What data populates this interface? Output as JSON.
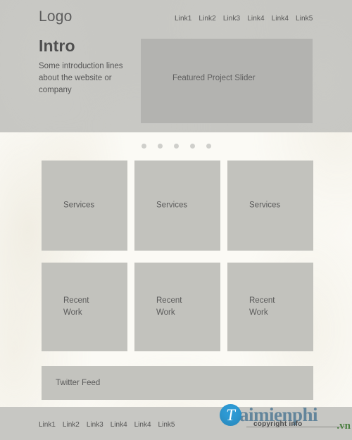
{
  "colors": {
    "header_band": "#c7c7c3",
    "footer_band": "#c7c7c3",
    "body_background": "#fbfaf5",
    "card_fill": "#c2c2bd",
    "slider_fill": "#b3b3b0",
    "twitter_fill": "#c3c3be",
    "dot_fill": "#cfcfcb",
    "text_primary": "#4f4f4f",
    "text_secondary": "#565656",
    "watermark_badge": "#2e9ad4",
    "watermark_word": "#63859b",
    "watermark_tld": "#4a7f3f"
  },
  "header": {
    "logo": "Logo",
    "nav": [
      {
        "label": "Link1"
      },
      {
        "label": "Link2"
      },
      {
        "label": "Link3"
      },
      {
        "label": "Link4"
      },
      {
        "label": "Link4"
      },
      {
        "label": "Link5"
      }
    ],
    "intro": {
      "title": "Intro",
      "body": "Some introduction lines about the website or company"
    },
    "slider": {
      "label": "Featured Project Slider"
    }
  },
  "slider_dots": {
    "count": 5,
    "active_index": null
  },
  "main": {
    "services": [
      {
        "label": "Services"
      },
      {
        "label": "Services"
      },
      {
        "label": "Services"
      }
    ],
    "recent_work": [
      {
        "label": "Recent\nWork"
      },
      {
        "label": "Recent\nWork"
      },
      {
        "label": "Recent\nWork"
      }
    ],
    "twitter_feed": {
      "label": "Twitter Feed"
    }
  },
  "footer": {
    "nav": [
      {
        "label": "Link1"
      },
      {
        "label": "Link2"
      },
      {
        "label": "Link3"
      },
      {
        "label": "Link4"
      },
      {
        "label": "Link4"
      },
      {
        "label": "Link5"
      }
    ]
  },
  "watermark": {
    "badge_letter": "T",
    "word": "aimienphi",
    "tld": ".vn",
    "copyright": "copyright info"
  }
}
